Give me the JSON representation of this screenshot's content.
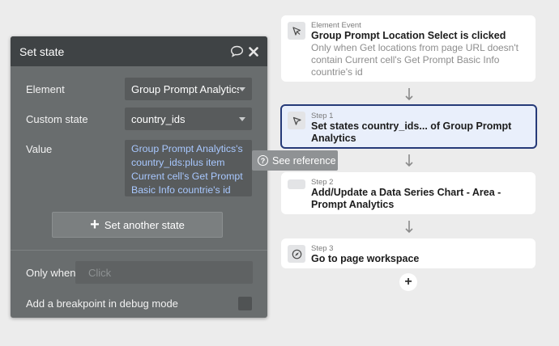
{
  "panel": {
    "title": "Set state",
    "element_label": "Element",
    "element_value": "Group Prompt Analytics",
    "custom_state_label": "Custom state",
    "custom_state_value": "country_ids",
    "value_label": "Value",
    "value_lines": [
      "Group Prompt Analytics's",
      "country_ids:plus item",
      "Current cell's Get Prompt",
      "Basic Info countrie's id"
    ],
    "set_another_label": "Set another state",
    "only_when_label": "Only when",
    "only_when_placeholder": "Click",
    "breakpoint_label": "Add a breakpoint in debug mode"
  },
  "tooltip": {
    "label": "See reference"
  },
  "workflow": {
    "event": {
      "kicker": "Element Event",
      "title": "Group Prompt Location Select is clicked",
      "condition_lines": [
        "Only when Get locations from page URL doesn't",
        "contain Current cell's Get Prompt Basic Info",
        "countrie's id"
      ]
    },
    "steps": [
      {
        "kicker": "Step 1",
        "title_lines": [
          "Set states country_ids... of Group Prompt",
          "Analytics"
        ]
      },
      {
        "kicker": "Step 2",
        "title_lines": [
          "Add/Update a Data Series Chart - Area -",
          "Prompt Analytics"
        ]
      },
      {
        "kicker": "Step 3",
        "title_lines": [
          "Go to page workspace"
        ]
      }
    ],
    "add_step_symbol": "+"
  },
  "icons": {
    "comment": "comment-icon",
    "close": "close-icon",
    "pointer": "pointer-icon",
    "compass": "compass-icon",
    "help": "help-circle-icon"
  },
  "colors": {
    "panel_bg": "#696d6e",
    "panel_header": "#3f4345",
    "expression_text": "#a8c8ff",
    "selected_border": "#263a78",
    "selected_bg": "#e9effb"
  }
}
